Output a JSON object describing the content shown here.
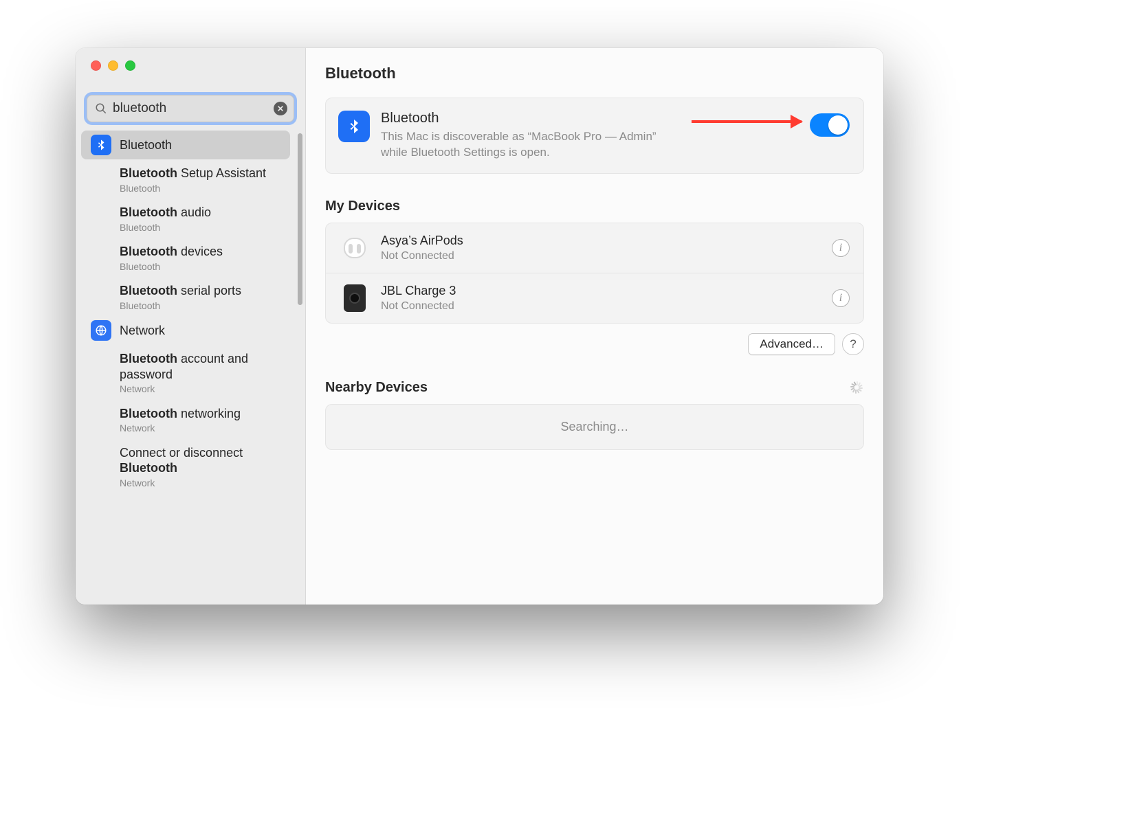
{
  "search": {
    "value": "bluetooth"
  },
  "sidebar": {
    "groups": [
      {
        "icon": "bluetooth",
        "header": "Bluetooth",
        "selected": true,
        "items": [
          {
            "title_parts": [
              [
                "Bluetooth",
                true
              ],
              [
                " Setup Assistant",
                false
              ]
            ],
            "sub": "Bluetooth"
          },
          {
            "title_parts": [
              [
                "Bluetooth",
                true
              ],
              [
                " audio",
                false
              ]
            ],
            "sub": "Bluetooth"
          },
          {
            "title_parts": [
              [
                "Bluetooth",
                true
              ],
              [
                " devices",
                false
              ]
            ],
            "sub": "Bluetooth"
          },
          {
            "title_parts": [
              [
                "Bluetooth",
                true
              ],
              [
                " serial ports",
                false
              ]
            ],
            "sub": "Bluetooth"
          }
        ]
      },
      {
        "icon": "network",
        "header": "Network",
        "selected": false,
        "items": [
          {
            "title_parts": [
              [
                "Bluetooth",
                true
              ],
              [
                " account and password",
                false
              ]
            ],
            "sub": "Network"
          },
          {
            "title_parts": [
              [
                "Bluetooth",
                true
              ],
              [
                " networking",
                false
              ]
            ],
            "sub": "Network"
          },
          {
            "title_parts": [
              [
                "Connect or disconnect ",
                false
              ],
              [
                "Bluetooth",
                true
              ]
            ],
            "sub": "Network"
          }
        ]
      }
    ]
  },
  "page": {
    "title": "Bluetooth",
    "bt_card": {
      "heading": "Bluetooth",
      "desc": "This Mac is discoverable as “MacBook Pro — Admin” while Bluetooth Settings is open.",
      "toggle_on": true
    },
    "my_devices": {
      "title": "My Devices",
      "devices": [
        {
          "name": "Asya’s AirPods",
          "status": "Not Connected",
          "icon": "airpods"
        },
        {
          "name": "JBL Charge 3",
          "status": "Not Connected",
          "icon": "speaker"
        }
      ],
      "advanced_label": "Advanced…",
      "help_label": "?"
    },
    "nearby": {
      "title": "Nearby Devices",
      "status": "Searching…"
    }
  }
}
